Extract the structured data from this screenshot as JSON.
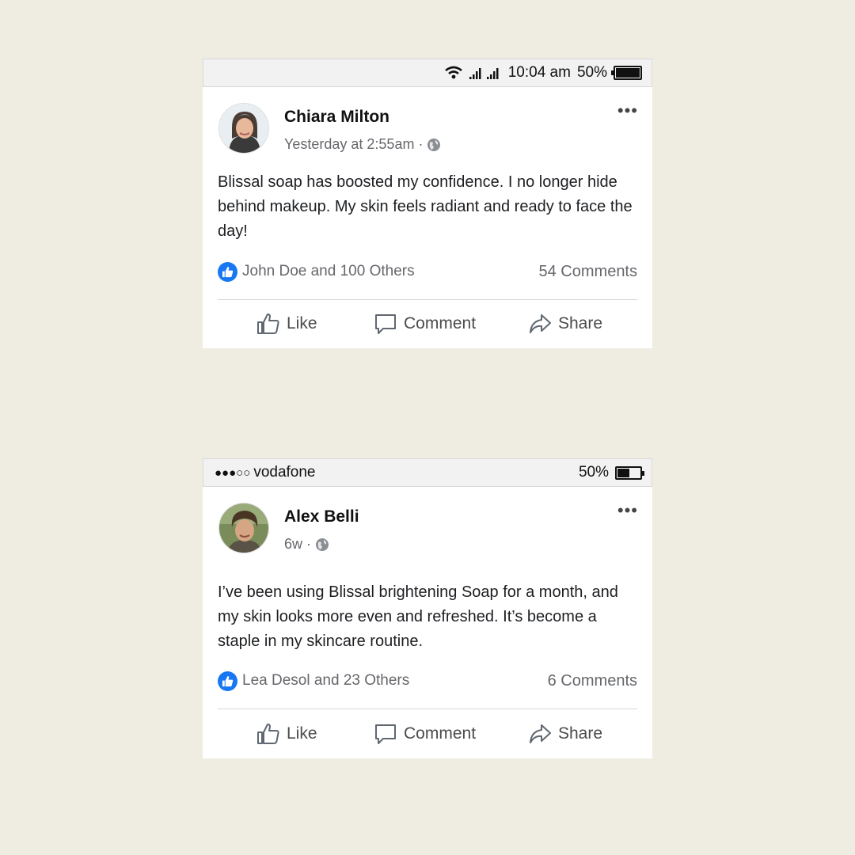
{
  "posts": [
    {
      "statusbar": {
        "time": "10:04 am",
        "battery": "50%",
        "wifi_icon": "wifi-icon",
        "signal_icon": "signal-bars-icon"
      },
      "author": "Chiara Milton",
      "timestamp": "Yesterday at 2:55am",
      "separator": "·",
      "text": "Blissal soap has boosted my confidence. I no longer hide behind makeup. My skin feels radiant and ready to face the day!",
      "likes": "John Doe and 100 Others",
      "comments": "54 Comments",
      "actions": {
        "like": "Like",
        "comment": "Comment",
        "share": "Share"
      }
    },
    {
      "statusbar": {
        "signal_dots": "●●●○○",
        "carrier": "vodafone",
        "battery": "50%"
      },
      "author": "Alex Belli",
      "timestamp": "6w",
      "separator": "·",
      "text": "I’ve been using Blissal brightening Soap for a month, and my skin looks more even and refreshed. It’s become a staple in my skincare routine.",
      "likes": "Lea Desol and 23 Others",
      "comments": "6 Comments",
      "actions": {
        "like": "Like",
        "comment": "Comment",
        "share": "Share"
      }
    }
  ],
  "colors": {
    "background": "#efece2",
    "like_blue": "#1877f2",
    "meta_gray": "#65676b"
  }
}
